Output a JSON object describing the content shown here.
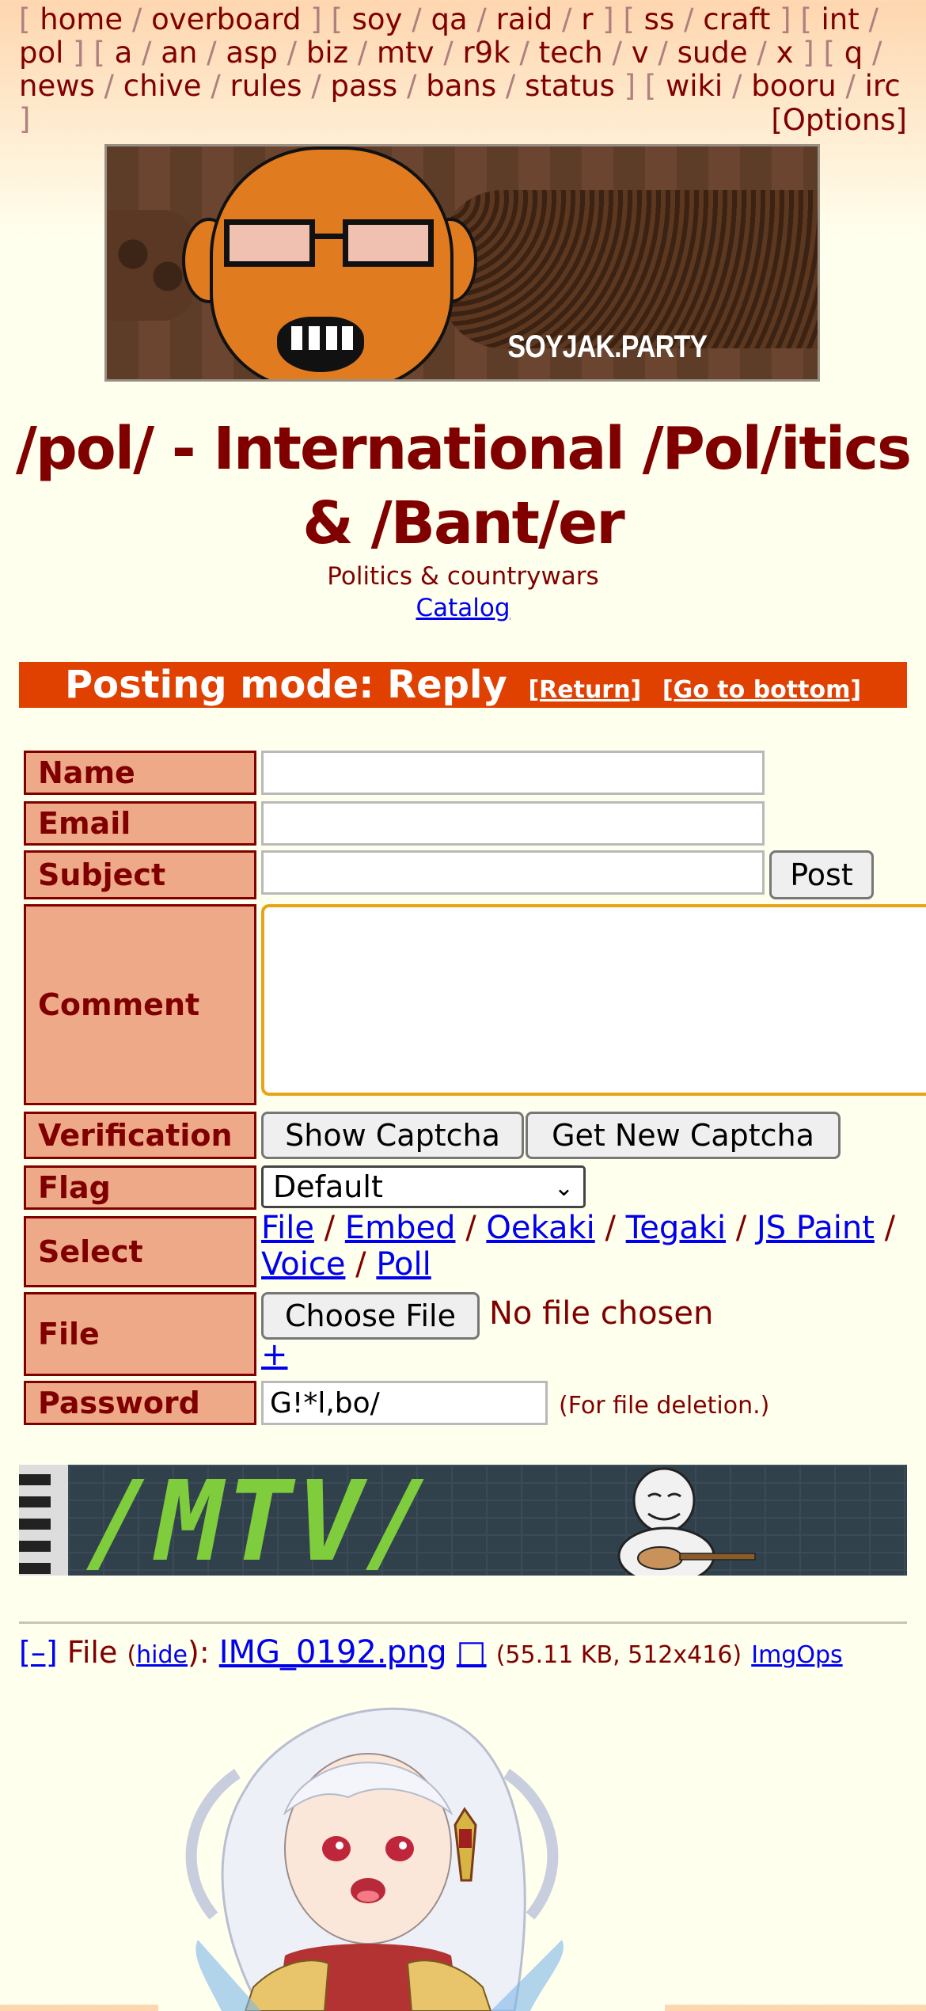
{
  "nav": {
    "lines": [
      [
        {
          "t": "[",
          "k": "br"
        },
        {
          "t": "home",
          "k": "link"
        },
        {
          "t": "/",
          "k": "sep"
        },
        {
          "t": "overboard",
          "k": "link"
        },
        {
          "t": "]",
          "k": "br"
        },
        {
          "t": "[",
          "k": "br"
        },
        {
          "t": "soy",
          "k": "link"
        },
        {
          "t": "/",
          "k": "sep"
        },
        {
          "t": "qa",
          "k": "link"
        },
        {
          "t": "/",
          "k": "sep"
        },
        {
          "t": "raid",
          "k": "link"
        },
        {
          "t": "/",
          "k": "sep"
        },
        {
          "t": "r",
          "k": "link"
        },
        {
          "t": "]",
          "k": "br"
        },
        {
          "t": "[",
          "k": "br"
        },
        {
          "t": "ss",
          "k": "link"
        },
        {
          "t": "/",
          "k": "sep"
        },
        {
          "t": "craft",
          "k": "link"
        },
        {
          "t": "]",
          "k": "br"
        },
        {
          "t": "[",
          "k": "br"
        },
        {
          "t": "int",
          "k": "link"
        },
        {
          "t": "/",
          "k": "sep"
        }
      ],
      [
        {
          "t": "pol",
          "k": "link"
        },
        {
          "t": "]",
          "k": "br"
        },
        {
          "t": "[",
          "k": "br"
        },
        {
          "t": "a",
          "k": "link"
        },
        {
          "t": "/",
          "k": "sep"
        },
        {
          "t": "an",
          "k": "link"
        },
        {
          "t": "/",
          "k": "sep"
        },
        {
          "t": "asp",
          "k": "link"
        },
        {
          "t": "/",
          "k": "sep"
        },
        {
          "t": "biz",
          "k": "link"
        },
        {
          "t": "/",
          "k": "sep"
        },
        {
          "t": "mtv",
          "k": "link"
        },
        {
          "t": "/",
          "k": "sep"
        },
        {
          "t": "r9k",
          "k": "link"
        },
        {
          "t": "/",
          "k": "sep"
        },
        {
          "t": "tech",
          "k": "link"
        },
        {
          "t": "/",
          "k": "sep"
        },
        {
          "t": "v",
          "k": "link"
        },
        {
          "t": "/",
          "k": "sep"
        },
        {
          "t": "sude",
          "k": "link"
        },
        {
          "t": "/",
          "k": "sep"
        },
        {
          "t": "x",
          "k": "link"
        },
        {
          "t": "]",
          "k": "br"
        },
        {
          "t": "[",
          "k": "br"
        },
        {
          "t": "q",
          "k": "link"
        },
        {
          "t": "/",
          "k": "sep"
        }
      ],
      [
        {
          "t": "news",
          "k": "link"
        },
        {
          "t": "/",
          "k": "sep"
        },
        {
          "t": "chive",
          "k": "link"
        },
        {
          "t": "/",
          "k": "sep"
        },
        {
          "t": "rules",
          "k": "link"
        },
        {
          "t": "/",
          "k": "sep"
        },
        {
          "t": "pass",
          "k": "link"
        },
        {
          "t": "/",
          "k": "sep"
        },
        {
          "t": "bans",
          "k": "link"
        },
        {
          "t": "/",
          "k": "sep"
        },
        {
          "t": "status",
          "k": "link"
        },
        {
          "t": "]",
          "k": "br"
        },
        {
          "t": "[",
          "k": "br"
        },
        {
          "t": "wiki",
          "k": "link"
        },
        {
          "t": "/",
          "k": "sep"
        },
        {
          "t": "booru",
          "k": "link"
        },
        {
          "t": "/",
          "k": "sep"
        },
        {
          "t": "irc",
          "k": "link"
        },
        {
          "t": "]",
          "k": "br"
        }
      ]
    ],
    "options": "[Options]"
  },
  "banner": {
    "brand": "SOYJAK.PARTY"
  },
  "board": {
    "title": "/pol/ - International /Pol/itics & /Bant/er",
    "subtitle": "Politics & countrywars",
    "catalog": "Catalog"
  },
  "posting_mode": {
    "label": "Posting mode: Reply",
    "return": "[Return]",
    "bottom": "[Go to bottom]"
  },
  "form": {
    "name_label": "Name",
    "email_label": "Email",
    "subject_label": "Subject",
    "comment_label": "Comment",
    "verification_label": "Verification",
    "flag_label": "Flag",
    "select_label": "Select",
    "file_label": "File",
    "password_label": "Password",
    "post_button": "Post",
    "show_captcha": "Show Captcha",
    "new_captcha": "Get New Captcha",
    "flag_value": "Default",
    "select_links": [
      "File",
      "Embed",
      "Oekaki",
      "Tegaki",
      "JS Paint",
      "Voice",
      "Poll"
    ],
    "choose_file": "Choose File",
    "no_file": "No file chosen",
    "plus": "+",
    "password_value": "G!*l,bo/",
    "password_hint": "(For file deletion.)"
  },
  "mtv_banner": {
    "text": "/MTV/"
  },
  "file": {
    "collapse": "[–]",
    "file_word": "File",
    "open_paren": "(",
    "hide": "hide",
    "close_paren": "):",
    "filename": "IMG_0192.png",
    "download_icon": "□",
    "meta": "(55.11 KB, 512x416)",
    "imgops": "ImgOps"
  },
  "colors": {
    "accent": "#800000",
    "posting_bar": "#e04000",
    "label_bg": "#eeaa88",
    "link": "#0000ee"
  }
}
